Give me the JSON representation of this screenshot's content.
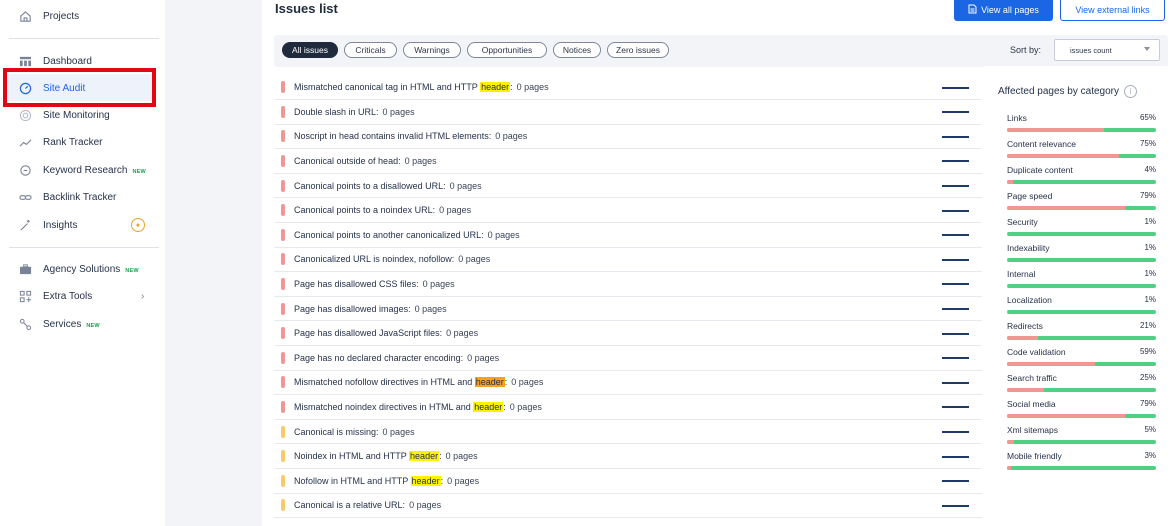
{
  "sidebar": {
    "items": [
      {
        "label": "Projects",
        "icon": "home-icon",
        "new": ""
      },
      {
        "label": "Dashboard",
        "icon": "dashboard-icon",
        "new": ""
      },
      {
        "label": "Site Audit",
        "icon": "speedometer-icon",
        "new": "",
        "active": true
      },
      {
        "label": "Site Monitoring",
        "icon": "monitoring-icon",
        "new": ""
      },
      {
        "label": "Rank Tracker",
        "icon": "trend-line-icon",
        "new": ""
      },
      {
        "label": "Keyword Research",
        "icon": "keyword-icon",
        "new": "NEW"
      },
      {
        "label": "Backlink Tracker",
        "icon": "link-icon",
        "new": ""
      },
      {
        "label": "Insights",
        "icon": "wand-icon",
        "new": ""
      },
      {
        "label": "Agency Solutions",
        "icon": "briefcase-icon",
        "new": "NEW"
      },
      {
        "label": "Extra Tools",
        "icon": "grid-icon",
        "new": ""
      },
      {
        "label": "Services",
        "icon": "services-icon",
        "new": "NEW"
      }
    ]
  },
  "header": {
    "title": "Issues list",
    "view_all_pages": "View all pages",
    "view_external_links": "View external links"
  },
  "filters": {
    "chips": [
      "All issues",
      "Criticals",
      "Warnings",
      "Opportunities",
      "Notices",
      "Zero issues"
    ],
    "sort_label": "Sort by:",
    "sort_value": "issues count"
  },
  "colors": {
    "accent": "#1b66e5",
    "critical": "#f09792",
    "warning": "#fcc86a",
    "healthy_bar": "#4fd084",
    "highlight": "#fff200",
    "highlight_strong": "#f7a21b",
    "red_frame": "#e30613"
  },
  "issues": [
    {
      "pre": "Mismatched canonical tag in HTML and HTTP ",
      "hl": "header",
      "post": ":",
      "count": "0 pages",
      "severity": "critical",
      "hl_style": "yellow"
    },
    {
      "pre": "Double slash in URL:",
      "hl": "",
      "post": "",
      "count": "0 pages",
      "severity": "critical"
    },
    {
      "pre": "Noscript in head contains invalid HTML elements:",
      "hl": "",
      "post": "",
      "count": "0 pages",
      "severity": "critical"
    },
    {
      "pre": "Canonical outside of head:",
      "hl": "",
      "post": "",
      "count": "0 pages",
      "severity": "critical"
    },
    {
      "pre": "Canonical points to a disallowed URL:",
      "hl": "",
      "post": "",
      "count": "0 pages",
      "severity": "critical"
    },
    {
      "pre": "Canonical points to a noindex URL:",
      "hl": "",
      "post": "",
      "count": "0 pages",
      "severity": "critical"
    },
    {
      "pre": "Canonical points to another canonicalized URL:",
      "hl": "",
      "post": "",
      "count": "0 pages",
      "severity": "critical"
    },
    {
      "pre": "Canonicalized URL is noindex, nofollow:",
      "hl": "",
      "post": "",
      "count": "0 pages",
      "severity": "critical"
    },
    {
      "pre": "Page has disallowed CSS files:",
      "hl": "",
      "post": "",
      "count": "0 pages",
      "severity": "critical"
    },
    {
      "pre": "Page has disallowed images:",
      "hl": "",
      "post": "",
      "count": "0 pages",
      "severity": "critical"
    },
    {
      "pre": "Page has disallowed JavaScript files:",
      "hl": "",
      "post": "",
      "count": "0 pages",
      "severity": "critical"
    },
    {
      "pre": "Page has no declared character encoding:",
      "hl": "",
      "post": "",
      "count": "0 pages",
      "severity": "critical"
    },
    {
      "pre": "Mismatched nofollow directives in HTML and ",
      "hl": "header",
      "post": ":",
      "count": "0 pages",
      "severity": "critical",
      "hl_style": "orange"
    },
    {
      "pre": "Mismatched noindex directives in HTML and ",
      "hl": "header",
      "post": ":",
      "count": "0 pages",
      "severity": "critical",
      "hl_style": "yellow"
    },
    {
      "pre": "Canonical is missing:",
      "hl": "",
      "post": "",
      "count": "0 pages",
      "severity": "warning"
    },
    {
      "pre": "Noindex in HTML and HTTP ",
      "hl": "header",
      "post": ":",
      "count": "0 pages",
      "severity": "warning",
      "hl_style": "yellow"
    },
    {
      "pre": "Nofollow in HTML and HTTP ",
      "hl": "header",
      "post": ":",
      "count": "0 pages",
      "severity": "warning",
      "hl_style": "yellow"
    },
    {
      "pre": "Canonical is a relative URL:",
      "hl": "",
      "post": "",
      "count": "0 pages",
      "severity": "warning"
    }
  ],
  "affected": {
    "title": "Affected pages by category",
    "categories": [
      {
        "name": "Links",
        "pct": "65%",
        "value": 65
      },
      {
        "name": "Content relevance",
        "pct": "75%",
        "value": 75
      },
      {
        "name": "Duplicate content",
        "pct": "4%",
        "value": 4
      },
      {
        "name": "Page speed",
        "pct": "79%",
        "value": 79
      },
      {
        "name": "Security",
        "pct": "1%",
        "value": 1
      },
      {
        "name": "Indexability",
        "pct": "1%",
        "value": 1
      },
      {
        "name": "Internal",
        "pct": "1%",
        "value": 1
      },
      {
        "name": "Localization",
        "pct": "1%",
        "value": 1
      },
      {
        "name": "Redirects",
        "pct": "21%",
        "value": 21
      },
      {
        "name": "Code validation",
        "pct": "59%",
        "value": 59
      },
      {
        "name": "Search traffic",
        "pct": "25%",
        "value": 25
      },
      {
        "name": "Social media",
        "pct": "79%",
        "value": 79
      },
      {
        "name": "Xml sitemaps",
        "pct": "5%",
        "value": 5
      },
      {
        "name": "Mobile friendly",
        "pct": "3%",
        "value": 3
      }
    ]
  }
}
